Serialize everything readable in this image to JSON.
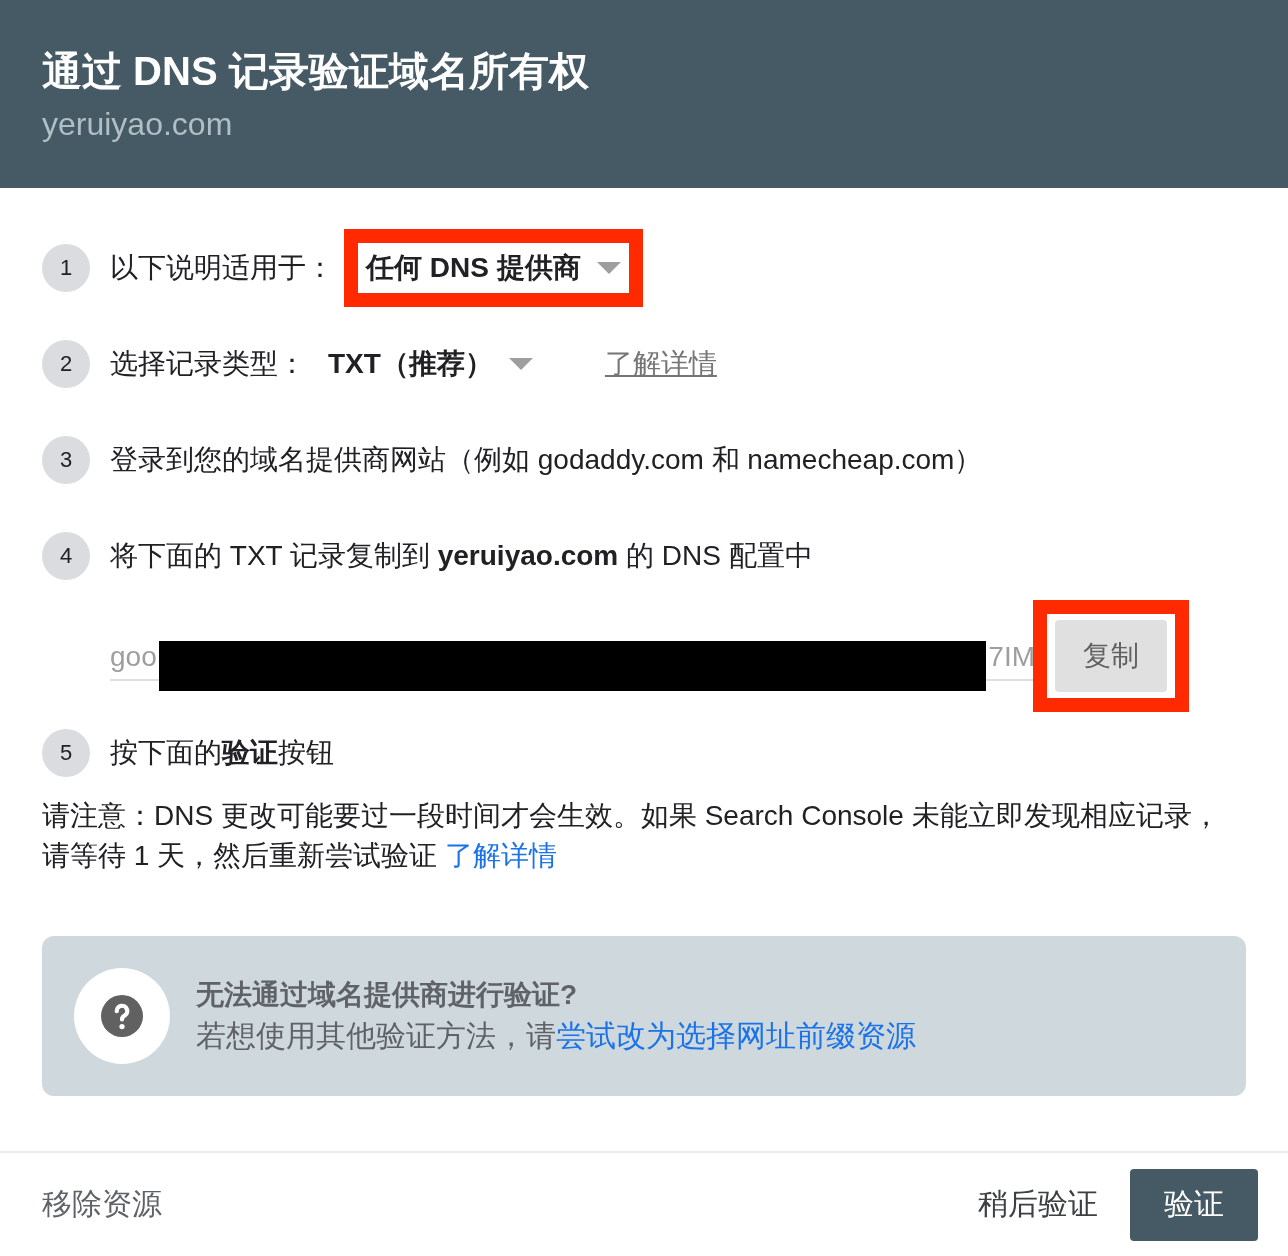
{
  "header": {
    "title": "通过 DNS 记录验证域名所有权",
    "subtitle": "yeruiyao.com"
  },
  "steps": [
    {
      "number": "1",
      "kind": "select",
      "label": "以下说明适用于：",
      "select": {
        "value": "任何 DNS 提供商",
        "highlighted": true
      }
    },
    {
      "number": "2",
      "kind": "select",
      "label": "选择记录类型：",
      "select": {
        "value": "TXT（推荐）",
        "highlighted": false
      },
      "link": "了解详情"
    },
    {
      "number": "3",
      "kind": "text",
      "text": "登录到您的域名提供商网站（例如 godaddy.com 和 namecheap.com）"
    },
    {
      "number": "4",
      "kind": "record",
      "text": "将下面的 TXT 记录复制到 **yeruiyao.com** 的 DNS 配置中",
      "record": {
        "visible_start": "goo",
        "visible_end": "7IM",
        "redacted": true
      },
      "copy_button": {
        "label": "复制",
        "highlighted": true
      }
    },
    {
      "number": "5",
      "kind": "text",
      "text": "按下面的**验证**按钮"
    }
  ],
  "note": {
    "text": "请注意：DNS 更改可能要过一段时间才会生效。如果 Search Console 未能立即发现相应记录，请等待 1 天，然后重新尝试验证",
    "link": "了解详情"
  },
  "help_box": {
    "title": "无法通过域名提供商进行验证?",
    "text": "若想使用其他验证方法，请",
    "link": "尝试改为选择网址前缀资源"
  },
  "footer": {
    "remove": "移除资源",
    "later": "稍后验证",
    "verify": "验证"
  }
}
